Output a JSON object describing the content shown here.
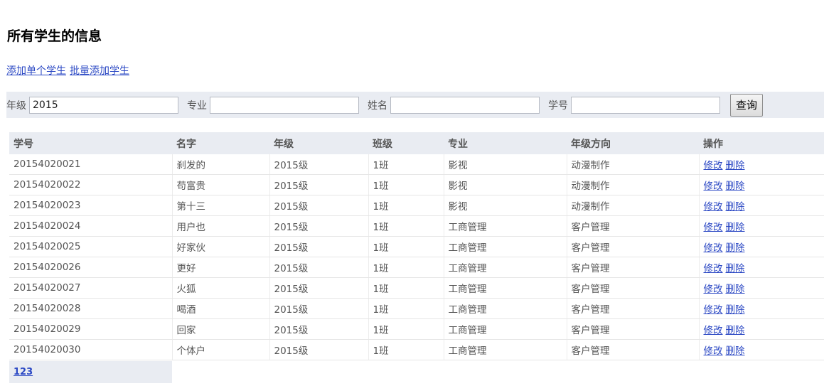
{
  "page": {
    "title": "所有学生的信息"
  },
  "actions": {
    "add_single": "添加单个学生",
    "add_batch": "批量添加学生"
  },
  "search": {
    "grade_label": "年级",
    "grade_value": "2015",
    "major_label": "专业",
    "major_value": "",
    "name_label": "姓名",
    "name_value": "",
    "id_label": "学号",
    "id_value": "",
    "submit": "查询"
  },
  "table": {
    "headers": [
      "学号",
      "名字",
      "年级",
      "班级",
      "专业",
      "年级方向",
      "操作"
    ],
    "edit_label": "修改",
    "delete_label": "删除",
    "rows": [
      [
        "20154020021",
        "刹发的",
        "2015级",
        "1班",
        "影视",
        "动漫制作"
      ],
      [
        "20154020022",
        "苟富贵",
        "2015级",
        "1班",
        "影视",
        "动漫制作"
      ],
      [
        "20154020023",
        "第十三",
        "2015级",
        "1班",
        "影视",
        "动漫制作"
      ],
      [
        "20154020024",
        "用户也",
        "2015级",
        "1班",
        "工商管理",
        "客户管理"
      ],
      [
        "20154020025",
        "好家伙",
        "2015级",
        "1班",
        "工商管理",
        "客户管理"
      ],
      [
        "20154020026",
        "更好",
        "2015级",
        "1班",
        "工商管理",
        "客户管理"
      ],
      [
        "20154020027",
        "火狐",
        "2015级",
        "1班",
        "工商管理",
        "客户管理"
      ],
      [
        "20154020028",
        "喝酒",
        "2015级",
        "1班",
        "工商管理",
        "客户管理"
      ],
      [
        "20154020029",
        "回家",
        "2015级",
        "1班",
        "工商管理",
        "客户管理"
      ],
      [
        "20154020030",
        "个体户",
        "2015级",
        "1班",
        "工商管理",
        "客户管理"
      ]
    ]
  },
  "pagination": {
    "pages": "123"
  }
}
